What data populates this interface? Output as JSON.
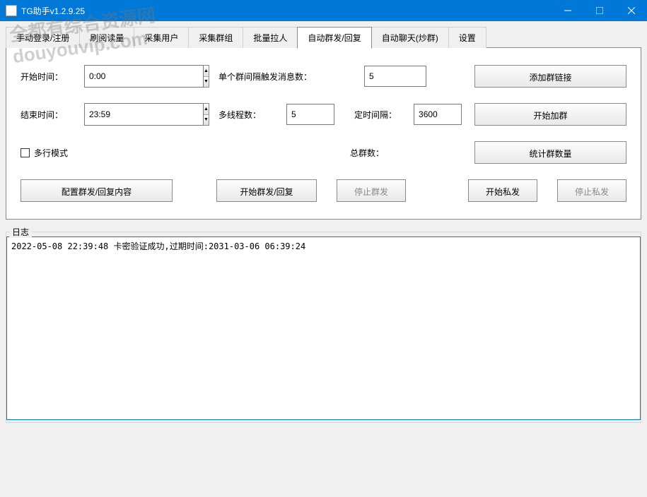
{
  "window": {
    "title": "TG助手v1.2.9.25"
  },
  "tabs": {
    "t0": "手动登录/注册",
    "t1": "刷阅读量",
    "t2": "采集用户",
    "t3": "采集群组",
    "t4": "批量拉人",
    "t5": "自动群发/回复",
    "t6": "自动聊天(炒群)",
    "t7": "设置"
  },
  "form": {
    "start_time_label": "开始时间：",
    "start_time_value": "0:00",
    "end_time_label": "结束时间：",
    "end_time_value": "23:59",
    "msg_count_label": "单个群间隔触发消息数：",
    "msg_count_value": "5",
    "threads_label": "多线程数：",
    "threads_value": "5",
    "interval_label": "定时间隔：",
    "interval_value": "3600",
    "multiline_label": "多行模式",
    "total_groups_label": "总群数："
  },
  "buttons": {
    "add_group_link": "添加群链接",
    "start_join": "开始加群",
    "count_groups": "统计群数量",
    "config_content": "配置群发/回复内容",
    "start_mass": "开始群发/回复",
    "stop_mass": "停止群发",
    "start_private": "开始私发",
    "stop_private": "停止私发"
  },
  "log": {
    "legend": "日志",
    "content": "2022-05-08 22:39:48 卡密验证成功,过期时间:2031-03-06 06:39:24"
  },
  "watermark": {
    "line1": "全都有综合资源网",
    "line2": "douyouvip.com"
  }
}
